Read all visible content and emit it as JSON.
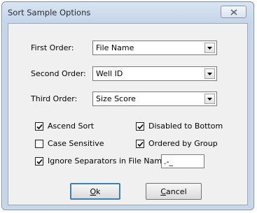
{
  "dialog": {
    "title": "Sort Sample Options",
    "close_label": "Close"
  },
  "orders": [
    {
      "label": "First Order:",
      "value": "File Name"
    },
    {
      "label": "Second Order:",
      "value": "Well ID"
    },
    {
      "label": "Third Order:",
      "value": "Size Score"
    }
  ],
  "options": {
    "ascend_sort": {
      "label": "Ascend Sort",
      "checked": true
    },
    "disabled_to_bottom": {
      "label": "Disabled to Bottom",
      "checked": true
    },
    "case_sensitive": {
      "label": "Case Sensitive",
      "checked": false
    },
    "ordered_by_group": {
      "label": "Ordered by Group",
      "checked": true
    },
    "ignore_separators": {
      "label": "Ignore Separators in File Name:",
      "checked": true
    }
  },
  "separators_value": ".-_",
  "buttons": {
    "ok": {
      "prefix": "",
      "underline": "O",
      "rest": "k"
    },
    "cancel": {
      "prefix": "",
      "underline": "C",
      "rest": "ancel"
    }
  },
  "icons": {
    "close": "close-icon",
    "dropdown": "chevron-down-icon",
    "check": "checkmark-icon"
  }
}
